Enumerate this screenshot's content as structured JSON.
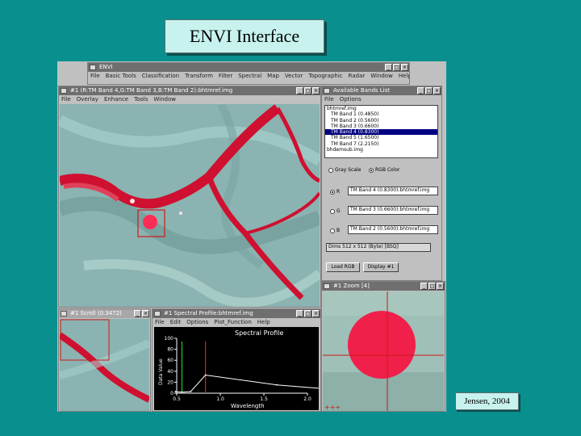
{
  "slide": {
    "title": "ENVI Interface",
    "credit": "Jensen, 2004"
  },
  "main_window": {
    "title": "ENVI",
    "menu": [
      "File",
      "Basic Tools",
      "Classification",
      "Transform",
      "Filter",
      "Spectral",
      "Map",
      "Vector",
      "Topographic",
      "Radar",
      "Window",
      "Help"
    ]
  },
  "display": {
    "title": "#1 (R:TM Band 4,G:TM Band 3,B:TM Band 2):bhtmref.img",
    "menu": [
      "File",
      "Overlay",
      "Enhance",
      "Tools",
      "Window"
    ]
  },
  "bands": {
    "title": "Available Bands List",
    "menu": [
      "File",
      "Options"
    ],
    "items": [
      "bhtmref.img",
      "TM Band 1 (0.4850)",
      "TM Band 2 (0.5600)",
      "TM Band 3 (0.6600)",
      "TM Band 4 (0.8300)",
      "TM Band 5 (1.6500)",
      "TM Band 7 (2.2150)",
      "bhdemsub.img"
    ],
    "selected_index": 4,
    "mode_gray": "Gray Scale",
    "mode_rgb": "RGB Color",
    "r_label": "R",
    "g_label": "G",
    "b_label": "B",
    "r_value": "TM Band 4 (0.8300):bhtmref.img",
    "g_value": "TM Band 3 (0.6600):bhtmref.img",
    "b_value": "TM Band 2 (0.5600):bhtmref.img",
    "dims": "Dims 512 x 512 (Byte) [BSQ]",
    "load_btn": "Load RGB",
    "display_btn": "Display #1"
  },
  "zoom": {
    "title": "#1 Zoom [4]"
  },
  "scroll": {
    "title": "#1 Scroll (0.3472)"
  },
  "spectral": {
    "title": "#1 Spectral Profile:bhtmref.img",
    "menu": [
      "File",
      "Edit",
      "Options",
      "Plot_Function",
      "Help"
    ]
  },
  "chart_data": {
    "type": "line",
    "title": "Spectral Profile",
    "xlabel": "Wavelength",
    "ylabel": "Data Value",
    "xlim": [
      0.5,
      2.0
    ],
    "ylim": [
      0,
      100
    ],
    "x_ticks": [
      "0.5",
      "1.0",
      "1.5",
      "2.0"
    ],
    "y_ticks": [
      "0",
      "20",
      "40",
      "60",
      "80",
      "100"
    ],
    "x": [
      0.485,
      0.56,
      0.66,
      0.83,
      1.65,
      2.215
    ],
    "series": [
      {
        "values": [
          3,
          2,
          3,
          33,
          15,
          8
        ]
      }
    ],
    "markers": [
      {
        "x": 0.56,
        "color": "#22cc22"
      },
      {
        "x": 0.83,
        "color": "#dd2222"
      }
    ]
  }
}
